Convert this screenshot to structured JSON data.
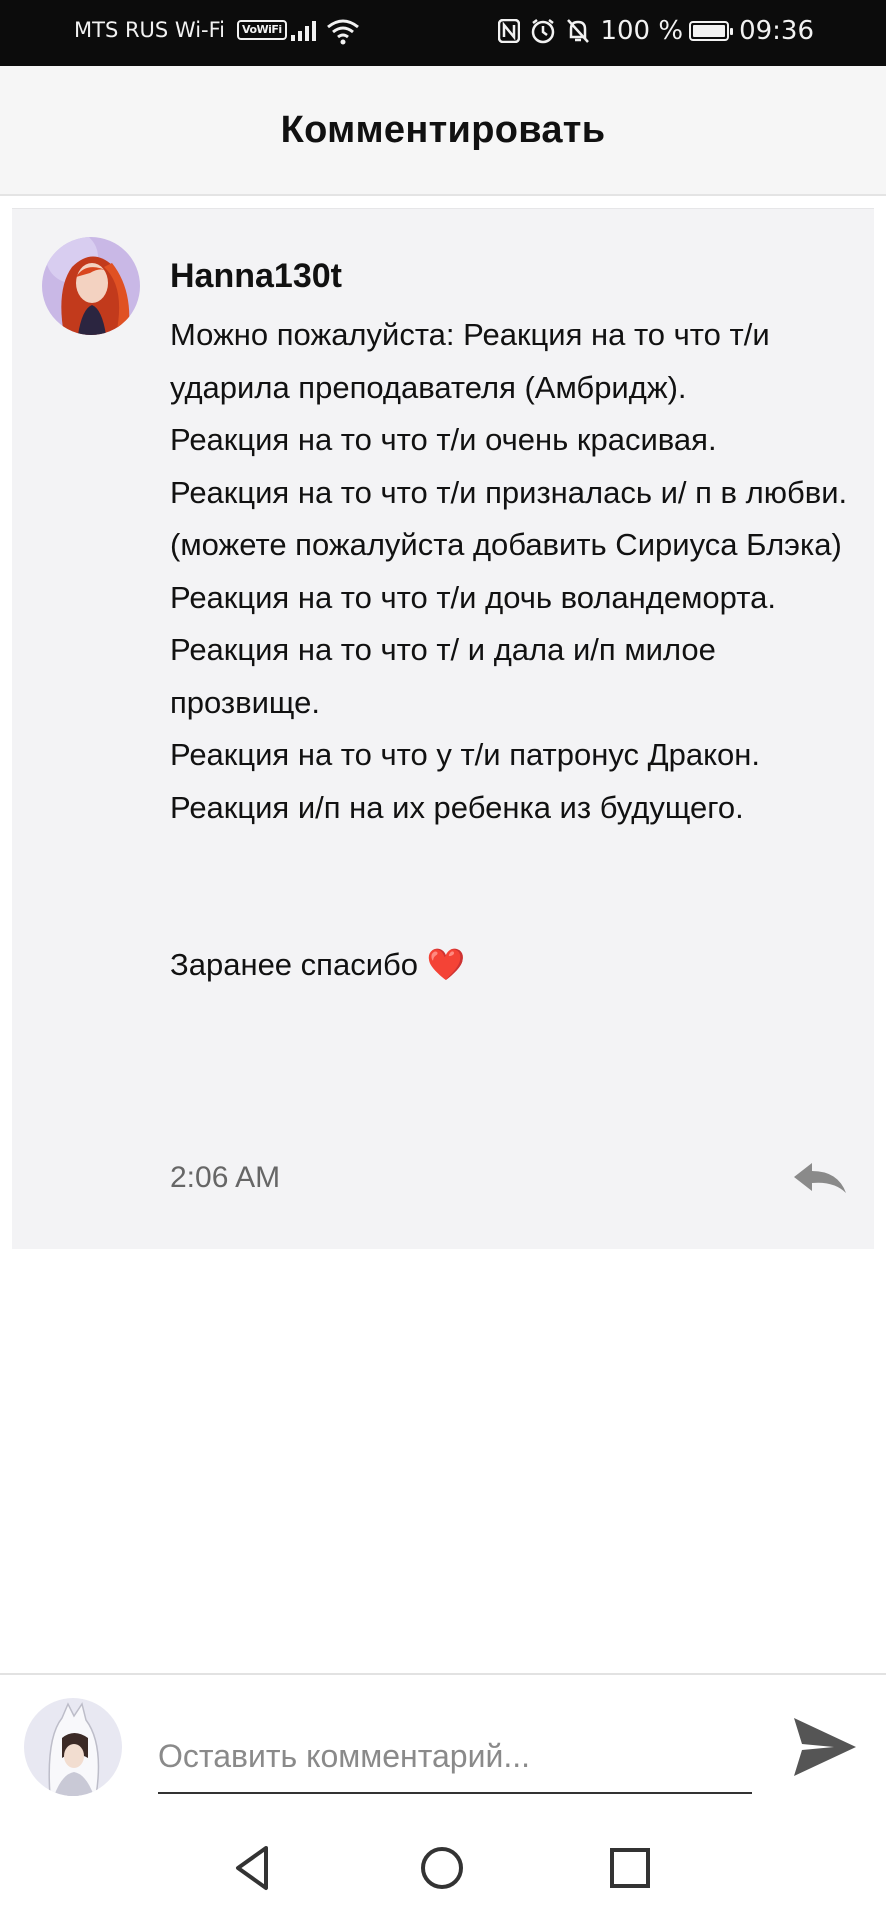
{
  "status_bar": {
    "carrier": "MTS RUS Wi-Fi",
    "vowifi": "VoWiFi",
    "battery": "100 %",
    "battery_level": 1.0,
    "time": "09:36",
    "icons": [
      "signal-icon",
      "wifi-icon",
      "nfc-icon",
      "alarm-icon",
      "mute-icon",
      "battery-icon"
    ]
  },
  "header": {
    "title": "Комментировать"
  },
  "comment": {
    "username": "Hanna130t",
    "paragraphs": [
      "Можно пожалуйста: Реакция на то что т/и ударила преподавателя (Амбридж).",
      "Реакция на то что т/и очень красивая.",
      "Реакция на то что т/и призналась и/ п в любви.(можете пожалуйста добавить Сириуса Блэка)",
      "Реакция на то что т/и дочь волан­деморта.",
      "Реакция на то что т/ и дала и/п милое прозвище.",
      "Реакция на то что у т/и патронус Дракон.",
      "Реакция и/п на их ребенка из будущего."
    ],
    "closing": "Заранее спасибо",
    "closing_emoji": "❤️",
    "time": "2:06 AM"
  },
  "input": {
    "placeholder": "Оставить комментарий..."
  },
  "colors": {
    "accent_text": "#111111",
    "muted": "#666666",
    "heart": "#e0141e",
    "card_bg": "#f3f3f5"
  }
}
